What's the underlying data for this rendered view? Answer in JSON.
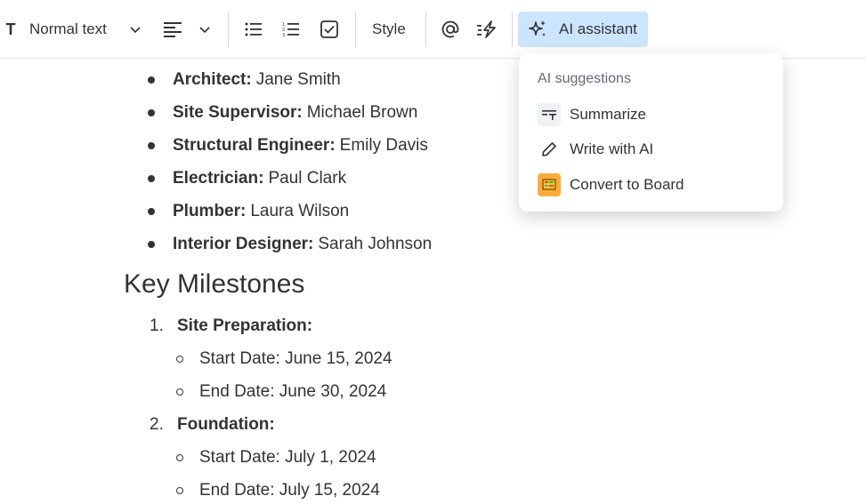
{
  "toolbar": {
    "text_icon_label": "T",
    "text_type_label": "Normal text",
    "style_label": "Style",
    "ai_assistant_label": "AI assistant"
  },
  "ai_menu": {
    "heading": "AI suggestions",
    "items": [
      {
        "label": "Summarize",
        "icon": "summarize-icon"
      },
      {
        "label": "Write with AI",
        "icon": "pencil-icon"
      },
      {
        "label": "Convert to Board",
        "icon": "board-icon"
      }
    ]
  },
  "document": {
    "team": [
      {
        "role": "Architect:",
        "name": "Jane Smith"
      },
      {
        "role": "Site Supervisor:",
        "name": "Michael Brown"
      },
      {
        "role": "Structural Engineer:",
        "name": "Emily Davis"
      },
      {
        "role": "Electrician:",
        "name": "Paul Clark"
      },
      {
        "role": "Plumber:",
        "name": "Laura Wilson"
      },
      {
        "role": "Interior Designer:",
        "name": "Sarah Johnson"
      }
    ],
    "milestones_heading": "Key Milestones",
    "milestones": [
      {
        "number": "1.",
        "title": "Site Preparation:",
        "start": "Start Date: June 15, 2024",
        "end": "End Date: June 30, 2024"
      },
      {
        "number": "2.",
        "title": "Foundation:",
        "start": "Start Date: July 1, 2024",
        "end": "End Date: July 15, 2024"
      }
    ]
  },
  "colors": {
    "ai_button_bg": "#cce5ff",
    "text": "#323338",
    "muted": "#676879",
    "board_icon": "#fdab3d"
  }
}
